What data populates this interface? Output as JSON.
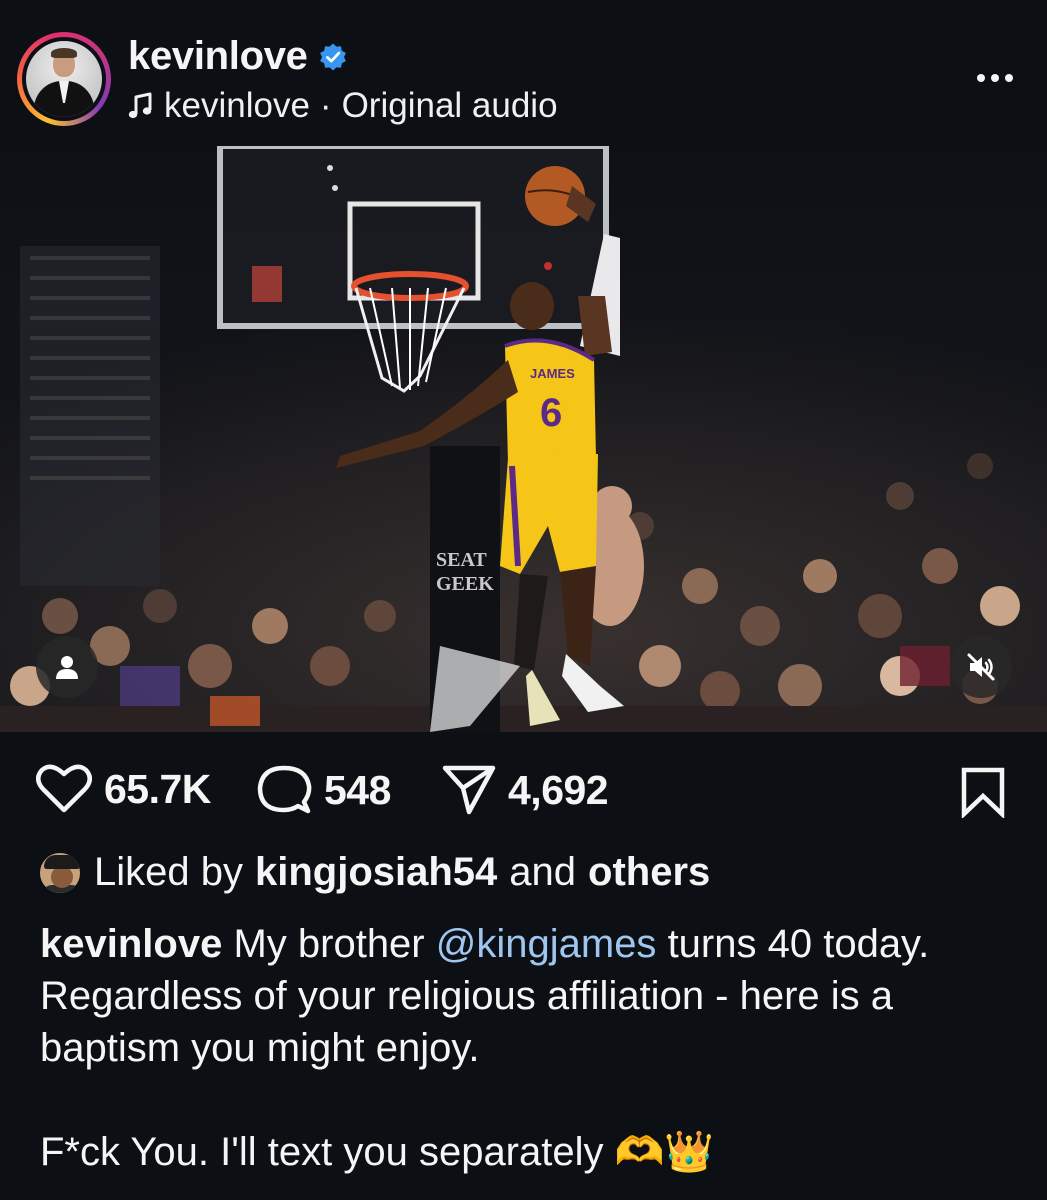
{
  "header": {
    "username": "kevinlove",
    "audio_owner": "kevinlove",
    "audio_separator": "·",
    "audio_label": "Original audio",
    "icons": [
      "verified-badge-icon",
      "music-note-icon",
      "more-options-icon"
    ]
  },
  "media": {
    "jersey_name": "JAMES",
    "jersey_number": "6",
    "sign_line1": "SEAT",
    "sign_line2": "GEEK",
    "icons": [
      "tagged-user-icon",
      "muted-audio-icon"
    ]
  },
  "actions": {
    "likes": "65.7K",
    "comments": "548",
    "shares": "4,692",
    "icons": [
      "heart-icon",
      "comment-icon",
      "share-icon",
      "bookmark-icon"
    ]
  },
  "liked_by": {
    "prefix": "Liked by",
    "user": "kingjosiah54",
    "connector": "and",
    "others": "others"
  },
  "caption": {
    "author": "kevinlove",
    "text_before_mention": "My brother",
    "mention": "@kingjames",
    "text_after_mention": "turns 40 today. Regardless of your religious affiliation - here is a baptism you might enjoy.",
    "second_paragraph": "F*ck You. I'll text you separately",
    "emojis": "🫶👑"
  },
  "colors": {
    "background": "#0c0f14",
    "text": "#f5f5f5",
    "mention": "#9fc6ef",
    "verified": "#3797f0",
    "jersey": "#f5c518"
  }
}
